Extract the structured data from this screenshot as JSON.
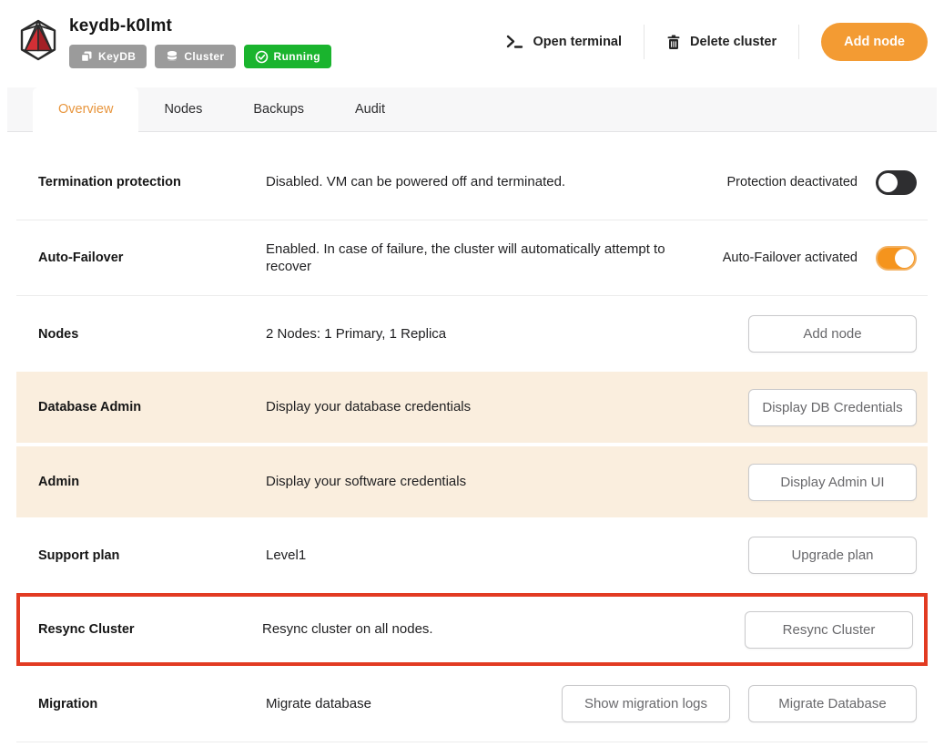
{
  "header": {
    "title": "keydb-k0lmt",
    "badges": [
      {
        "name": "keydb-badge",
        "label": "KeyDB",
        "icon": "layers-icon",
        "color": "#9b9b9b"
      },
      {
        "name": "cluster-badge",
        "label": "Cluster",
        "icon": "database-icon",
        "color": "#9b9b9b"
      },
      {
        "name": "status-badge",
        "label": "Running",
        "icon": "check-circle-icon",
        "color": "#1ab42e"
      }
    ],
    "actions": {
      "open_terminal": "Open terminal",
      "delete_cluster": "Delete cluster",
      "add_node": "Add node"
    }
  },
  "tabs": [
    {
      "label": "Overview",
      "active": true
    },
    {
      "label": "Nodes",
      "active": false
    },
    {
      "label": "Backups",
      "active": false
    },
    {
      "label": "Audit",
      "active": false
    }
  ],
  "rows": [
    {
      "label": "Termination protection",
      "description": "Disabled. VM can be powered off and terminated.",
      "control": {
        "type": "toggle",
        "state": "off",
        "text": "Protection deactivated"
      }
    },
    {
      "label": "Auto-Failover",
      "description": "Enabled. In case of failure, the cluster will automatically attempt to recover",
      "control": {
        "type": "toggle",
        "state": "on",
        "text": "Auto-Failover activated"
      }
    },
    {
      "label": "Nodes",
      "description": "2 Nodes: 1 Primary, 1 Replica",
      "control": {
        "type": "button",
        "text": "Add node"
      }
    },
    {
      "label": "Database Admin",
      "description": "Display your database credentials",
      "highlight": "beige",
      "control": {
        "type": "button",
        "text": "Display DB Credentials"
      }
    },
    {
      "label": "Admin",
      "description": "Display your software credentials",
      "highlight": "beige",
      "control": {
        "type": "button",
        "text": "Display Admin UI"
      }
    },
    {
      "label": "Support plan",
      "description": "Level1",
      "control": {
        "type": "button",
        "text": "Upgrade plan"
      }
    },
    {
      "label": "Resync Cluster",
      "description": "Resync cluster on all nodes.",
      "highlight": "red-outline",
      "control": {
        "type": "button",
        "text": "Resync Cluster"
      }
    },
    {
      "label": "Migration",
      "description": "Migrate database",
      "buttons": [
        "Show migration logs",
        "Migrate Database"
      ]
    }
  ],
  "colors": {
    "accent_orange": "#f39b33",
    "active_tab_text": "#e8963e",
    "status_green": "#1ab42e",
    "badge_gray": "#9b9b9b",
    "row_highlight_beige": "#faeede",
    "annotation_red": "#e23b22",
    "toggle_off": "#2e2e30",
    "toggle_on": "#f5941d"
  }
}
